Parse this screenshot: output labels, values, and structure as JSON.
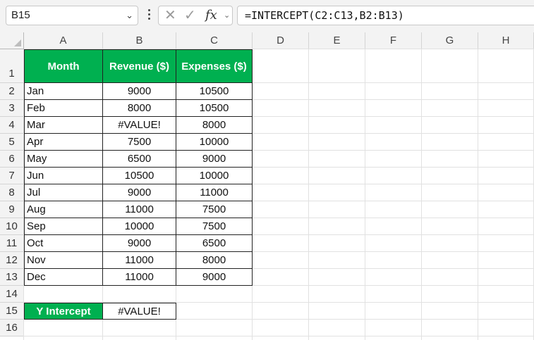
{
  "name_box": "B15",
  "formula": "=INTERCEPT(C2:C13,B2:B13)",
  "columns": [
    "A",
    "B",
    "C",
    "D",
    "E",
    "F",
    "G",
    "H"
  ],
  "rows": [
    "1",
    "2",
    "3",
    "4",
    "5",
    "6",
    "7",
    "8",
    "9",
    "10",
    "11",
    "12",
    "13",
    "14",
    "15",
    "16"
  ],
  "table": {
    "headers": [
      "Month",
      "Revenue ($)",
      "Expenses ($)"
    ],
    "data": [
      [
        "Jan",
        "9000",
        "10500"
      ],
      [
        "Feb",
        "8000",
        "10500"
      ],
      [
        "Mar",
        "#VALUE!",
        "8000"
      ],
      [
        "Apr",
        "7500",
        "10000"
      ],
      [
        "May",
        "6500",
        "9000"
      ],
      [
        "Jun",
        "10500",
        "10000"
      ],
      [
        "Jul",
        "9000",
        "11000"
      ],
      [
        "Aug",
        "11000",
        "7500"
      ],
      [
        "Sep",
        "10000",
        "7500"
      ],
      [
        "Oct",
        "9000",
        "6500"
      ],
      [
        "Nov",
        "11000",
        "8000"
      ],
      [
        "Dec",
        "11000",
        "9000"
      ]
    ]
  },
  "intercept": {
    "label": "Y Intercept",
    "value": "#VALUE!"
  },
  "colors": {
    "header_fill": "#00b050",
    "header_text": "#ffffff"
  }
}
